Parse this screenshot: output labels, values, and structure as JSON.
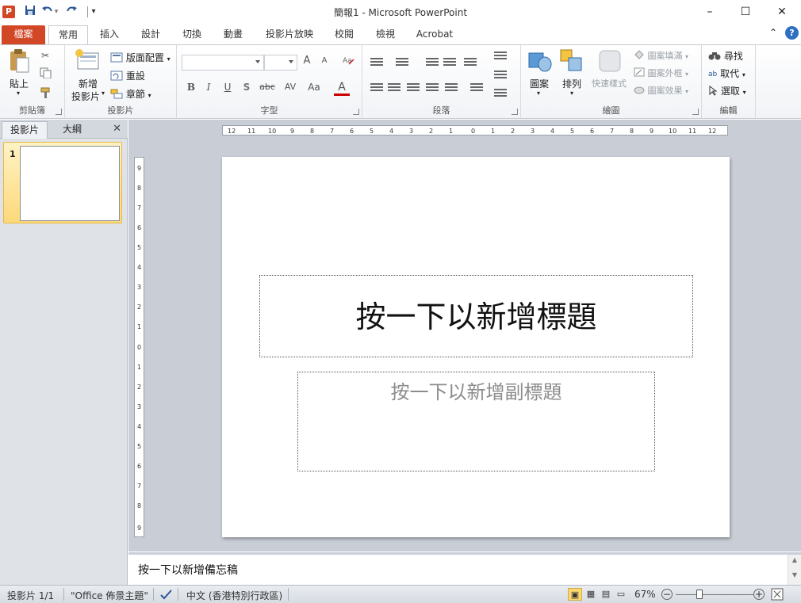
{
  "window": {
    "title": "簡報1 - Microsoft PowerPoint",
    "app_icon": "P",
    "minimize": "–",
    "maximize": "☐",
    "close": "✕"
  },
  "quick_access": {
    "save_icon": "save-icon",
    "undo_icon": "undo-icon",
    "redo_icon": "redo-icon",
    "customize_icon": "customize-icon"
  },
  "tabs": [
    "檔案",
    "常用",
    "插入",
    "設計",
    "切換",
    "動畫",
    "投影片放映",
    "校閱",
    "檢視",
    "Acrobat"
  ],
  "ribbon": {
    "clipboard": {
      "paste": "貼上",
      "label": "剪貼簿"
    },
    "slides": {
      "new_slide_line1": "新增",
      "new_slide_line2": "投影片",
      "layout": "版面配置",
      "reset": "重設",
      "section": "章節",
      "label": "投影片"
    },
    "font": {
      "label": "字型",
      "bold": "B",
      "italic": "I",
      "underline": "U",
      "shadow": "S",
      "strike": "abc",
      "spacing": "AV",
      "case": "Aa",
      "color": "A",
      "grow": "A",
      "shrink": "A"
    },
    "paragraph": {
      "label": "段落"
    },
    "drawing": {
      "shapes": "圖案",
      "arrange": "排列",
      "quick_styles": "快速樣式",
      "fill": "圖案填滿",
      "outline": "圖案外框",
      "effects": "圖案效果",
      "label": "繪圖"
    },
    "editing": {
      "find": "尋找",
      "replace": "取代",
      "select": "選取",
      "label": "編輯"
    }
  },
  "left_pane": {
    "tab_slides": "投影片",
    "tab_outline": "大綱",
    "close": "✕",
    "slide_number": "1"
  },
  "slide": {
    "title_placeholder": "按一下以新增標題",
    "subtitle_placeholder": "按一下以新增副標題"
  },
  "notes": {
    "placeholder": "按一下以新增備忘稿"
  },
  "status": {
    "slide_info": "投影片 1/1",
    "theme": "\"Office 佈景主題\"",
    "language": "中文 (香港特別行政區)",
    "zoom": "67%"
  }
}
